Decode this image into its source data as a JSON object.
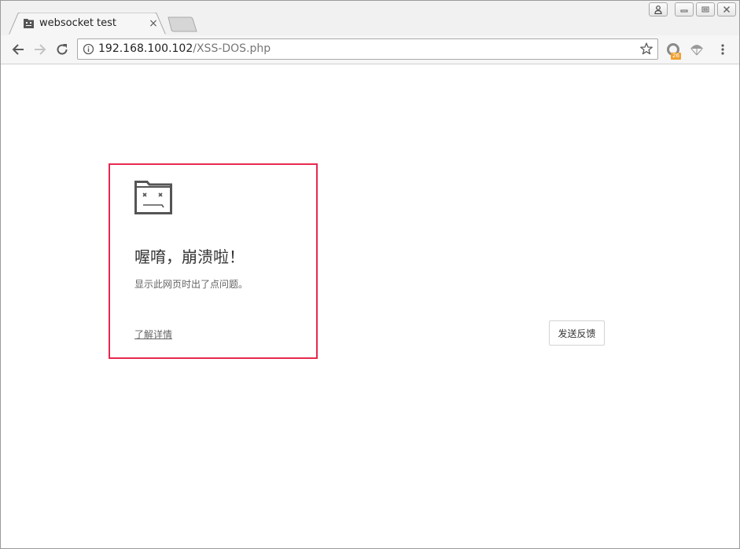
{
  "tab": {
    "title": "websocket test",
    "close_glyph": "×",
    "favicon": "sad-folder-icon"
  },
  "toolbar": {
    "back_icon": "back-arrow-icon",
    "forward_icon": "forward-arrow-icon",
    "reload_icon": "reload-icon",
    "url_host": "192.168.100.102",
    "url_path": "/XSS-DOS.php",
    "extension_badge": "26"
  },
  "crash_page": {
    "title": "喔唷，崩溃啦！",
    "message": "显示此网页时出了点问题。",
    "learn_more": "了解详情",
    "feedback_button": "发送反馈"
  },
  "colors": {
    "highlight_border": "#e8284e",
    "badge": "#f0a030"
  }
}
